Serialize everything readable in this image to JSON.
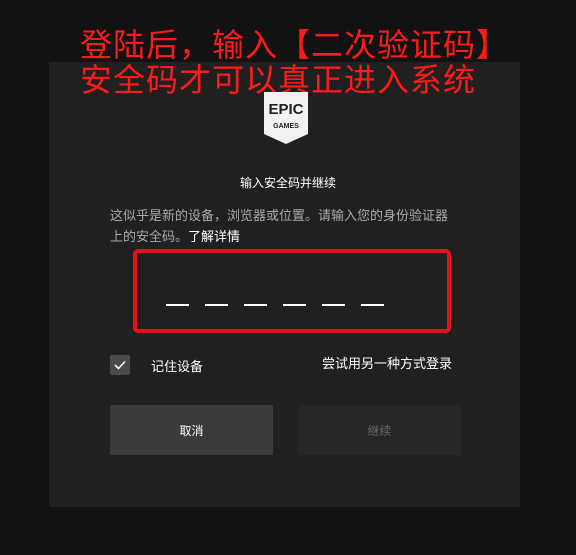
{
  "annotation": {
    "line1": "登陆后，输入【二次验证码】",
    "line2": "安全码才可以真正进入系统",
    "color": "#ff1a1a"
  },
  "logo": {
    "top_text": "EPIC",
    "bottom_text": "GAMES",
    "icon": "epic-games-logo"
  },
  "dialog": {
    "title": "输入安全码并继续",
    "description": "这似乎是新的设备，浏览器或位置。请输入您的身份验证器上的安全码。",
    "learn_more": "了解详情",
    "code_slots": 6,
    "remember_label": "记住设备",
    "remember_checked": true,
    "alt_login": "尝试用另一种方式登录",
    "cancel_label": "取消",
    "continue_label": "继续"
  },
  "colors": {
    "background": "#121212",
    "card": "#202020",
    "highlight_border": "#e8101a",
    "cancel_button": "#3b3b3b",
    "continue_button_disabled": "#262626"
  }
}
